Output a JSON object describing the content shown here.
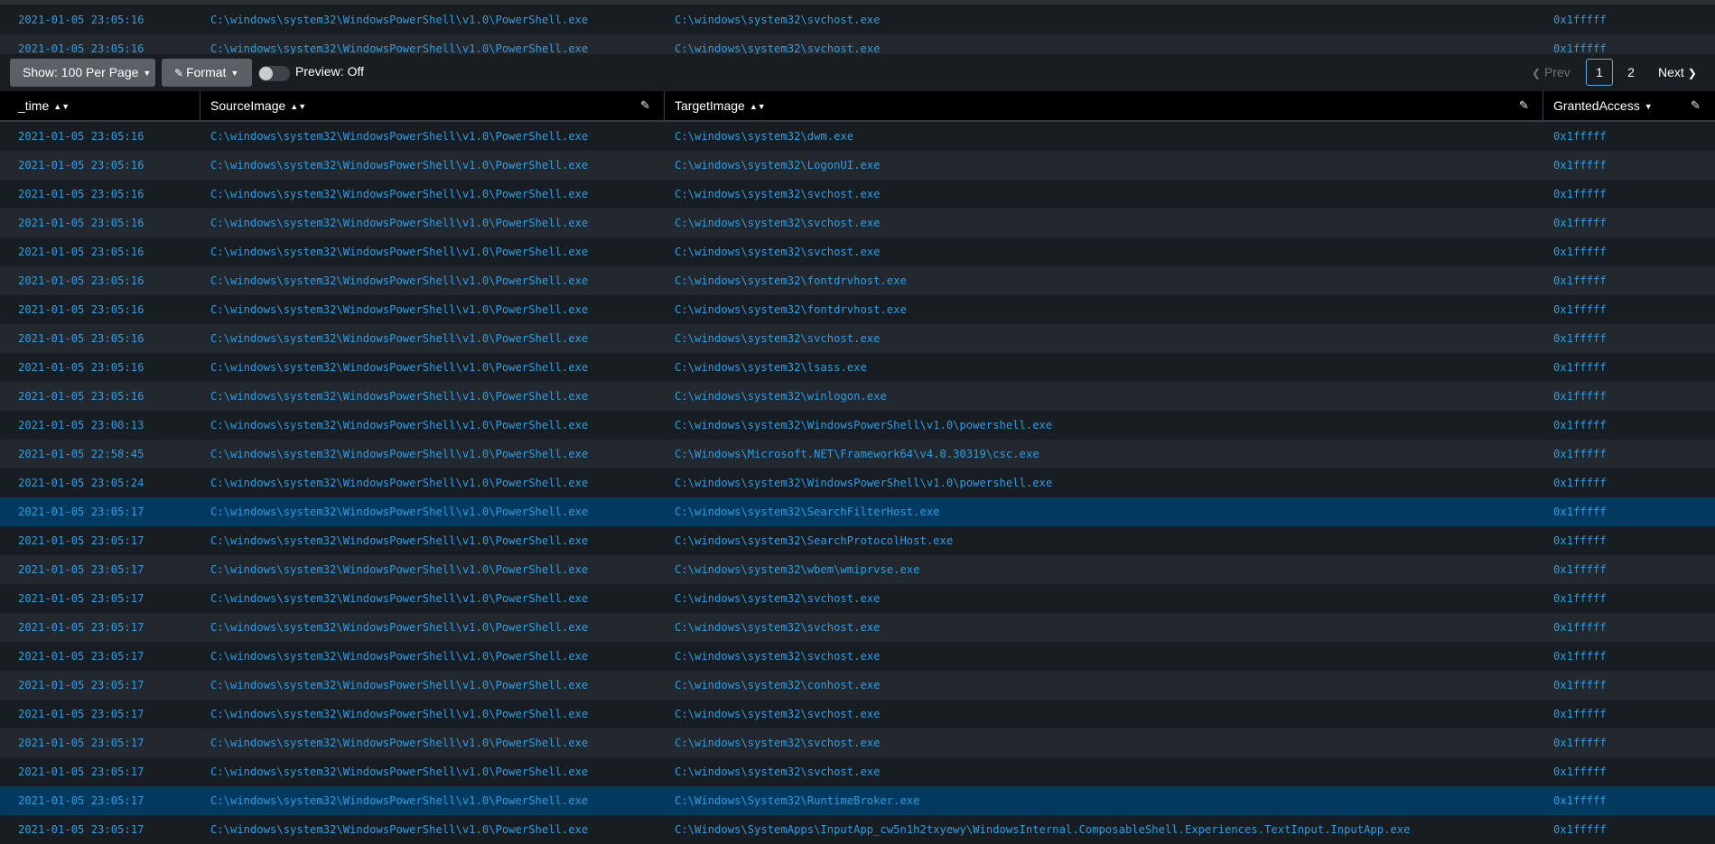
{
  "top_rows": [
    {
      "time": "2021-01-05 23:05:16",
      "source": "C:\\windows\\system32\\WindowsPowerShell\\v1.0\\PowerShell.exe",
      "target": "C:\\windows\\system32\\svchost.exe",
      "access": "0x1fffff"
    },
    {
      "time": "2021-01-05 23:05:16",
      "source": "C:\\windows\\system32\\WindowsPowerShell\\v1.0\\PowerShell.exe",
      "target": "C:\\windows\\system32\\svchost.exe",
      "access": "0x1fffff"
    }
  ],
  "toolbar": {
    "show_label": "Show: 100 Per Page",
    "format_label": "Format",
    "preview_label": "Preview: Off"
  },
  "pagination": {
    "prev_label": "Prev",
    "pages": [
      "1",
      "2"
    ],
    "current_page": "1",
    "next_label": "Next"
  },
  "columns": [
    "_time",
    "SourceImage",
    "TargetImage",
    "GrantedAccess"
  ],
  "rows": [
    {
      "time": "2021-01-05 23:05:16",
      "source": "C:\\windows\\system32\\WindowsPowerShell\\v1.0\\PowerShell.exe",
      "target": "C:\\windows\\system32\\dwm.exe",
      "access": "0x1fffff"
    },
    {
      "time": "2021-01-05 23:05:16",
      "source": "C:\\windows\\system32\\WindowsPowerShell\\v1.0\\PowerShell.exe",
      "target": "C:\\windows\\system32\\LogonUI.exe",
      "access": "0x1fffff"
    },
    {
      "time": "2021-01-05 23:05:16",
      "source": "C:\\windows\\system32\\WindowsPowerShell\\v1.0\\PowerShell.exe",
      "target": "C:\\windows\\system32\\svchost.exe",
      "access": "0x1fffff"
    },
    {
      "time": "2021-01-05 23:05:16",
      "source": "C:\\windows\\system32\\WindowsPowerShell\\v1.0\\PowerShell.exe",
      "target": "C:\\windows\\system32\\svchost.exe",
      "access": "0x1fffff"
    },
    {
      "time": "2021-01-05 23:05:16",
      "source": "C:\\windows\\system32\\WindowsPowerShell\\v1.0\\PowerShell.exe",
      "target": "C:\\windows\\system32\\svchost.exe",
      "access": "0x1fffff"
    },
    {
      "time": "2021-01-05 23:05:16",
      "source": "C:\\windows\\system32\\WindowsPowerShell\\v1.0\\PowerShell.exe",
      "target": "C:\\windows\\system32\\fontdrvhost.exe",
      "access": "0x1fffff"
    },
    {
      "time": "2021-01-05 23:05:16",
      "source": "C:\\windows\\system32\\WindowsPowerShell\\v1.0\\PowerShell.exe",
      "target": "C:\\windows\\system32\\fontdrvhost.exe",
      "access": "0x1fffff"
    },
    {
      "time": "2021-01-05 23:05:16",
      "source": "C:\\windows\\system32\\WindowsPowerShell\\v1.0\\PowerShell.exe",
      "target": "C:\\windows\\system32\\svchost.exe",
      "access": "0x1fffff"
    },
    {
      "time": "2021-01-05 23:05:16",
      "source": "C:\\windows\\system32\\WindowsPowerShell\\v1.0\\PowerShell.exe",
      "target": "C:\\windows\\system32\\lsass.exe",
      "access": "0x1fffff"
    },
    {
      "time": "2021-01-05 23:05:16",
      "source": "C:\\windows\\system32\\WindowsPowerShell\\v1.0\\PowerShell.exe",
      "target": "C:\\windows\\system32\\winlogon.exe",
      "access": "0x1fffff"
    },
    {
      "time": "2021-01-05 23:00:13",
      "source": "C:\\windows\\system32\\WindowsPowerShell\\v1.0\\PowerShell.exe",
      "target": "C:\\windows\\system32\\WindowsPowerShell\\v1.0\\powershell.exe",
      "access": "0x1fffff"
    },
    {
      "time": "2021-01-05 22:58:45",
      "source": "C:\\windows\\system32\\WindowsPowerShell\\v1.0\\PowerShell.exe",
      "target": "C:\\Windows\\Microsoft.NET\\Framework64\\v4.0.30319\\csc.exe",
      "access": "0x1fffff"
    },
    {
      "time": "2021-01-05 23:05:24",
      "source": "C:\\windows\\system32\\WindowsPowerShell\\v1.0\\PowerShell.exe",
      "target": "C:\\windows\\system32\\WindowsPowerShell\\v1.0\\powershell.exe",
      "access": "0x1fffff"
    },
    {
      "time": "2021-01-05 23:05:17",
      "source": "C:\\windows\\system32\\WindowsPowerShell\\v1.0\\PowerShell.exe",
      "target": "C:\\windows\\system32\\SearchFilterHost.exe",
      "access": "0x1fffff",
      "selected": true
    },
    {
      "time": "2021-01-05 23:05:17",
      "source": "C:\\windows\\system32\\WindowsPowerShell\\v1.0\\PowerShell.exe",
      "target": "C:\\windows\\system32\\SearchProtocolHost.exe",
      "access": "0x1fffff"
    },
    {
      "time": "2021-01-05 23:05:17",
      "source": "C:\\windows\\system32\\WindowsPowerShell\\v1.0\\PowerShell.exe",
      "target": "C:\\windows\\system32\\wbem\\wmiprvse.exe",
      "access": "0x1fffff"
    },
    {
      "time": "2021-01-05 23:05:17",
      "source": "C:\\windows\\system32\\WindowsPowerShell\\v1.0\\PowerShell.exe",
      "target": "C:\\windows\\system32\\svchost.exe",
      "access": "0x1fffff"
    },
    {
      "time": "2021-01-05 23:05:17",
      "source": "C:\\windows\\system32\\WindowsPowerShell\\v1.0\\PowerShell.exe",
      "target": "C:\\windows\\system32\\svchost.exe",
      "access": "0x1fffff"
    },
    {
      "time": "2021-01-05 23:05:17",
      "source": "C:\\windows\\system32\\WindowsPowerShell\\v1.0\\PowerShell.exe",
      "target": "C:\\windows\\system32\\svchost.exe",
      "access": "0x1fffff"
    },
    {
      "time": "2021-01-05 23:05:17",
      "source": "C:\\windows\\system32\\WindowsPowerShell\\v1.0\\PowerShell.exe",
      "target": "C:\\windows\\system32\\conhost.exe",
      "access": "0x1fffff"
    },
    {
      "time": "2021-01-05 23:05:17",
      "source": "C:\\windows\\system32\\WindowsPowerShell\\v1.0\\PowerShell.exe",
      "target": "C:\\windows\\system32\\svchost.exe",
      "access": "0x1fffff"
    },
    {
      "time": "2021-01-05 23:05:17",
      "source": "C:\\windows\\system32\\WindowsPowerShell\\v1.0\\PowerShell.exe",
      "target": "C:\\windows\\system32\\svchost.exe",
      "access": "0x1fffff"
    },
    {
      "time": "2021-01-05 23:05:17",
      "source": "C:\\windows\\system32\\WindowsPowerShell\\v1.0\\PowerShell.exe",
      "target": "C:\\windows\\system32\\svchost.exe",
      "access": "0x1fffff"
    },
    {
      "time": "2021-01-05 23:05:17",
      "source": "C:\\windows\\system32\\WindowsPowerShell\\v1.0\\PowerShell.exe",
      "target": "C:\\Windows\\System32\\RuntimeBroker.exe",
      "access": "0x1fffff",
      "selected": true
    },
    {
      "time": "2021-01-05 23:05:17",
      "source": "C:\\windows\\system32\\WindowsPowerShell\\v1.0\\PowerShell.exe",
      "target": "C:\\Windows\\SystemApps\\InputApp_cw5n1h2txyewy\\WindowsInternal.ComposableShell.Experiences.TextInput.InputApp.exe",
      "access": "0x1fffff"
    }
  ],
  "colors": {
    "background": "#171d21",
    "alt_row": "#22282d",
    "selected_row": "#02395e",
    "link": "#2e9de0",
    "header_bg": "#000000",
    "button_bg": "#5a6066"
  },
  "icons": {
    "sort": "sort-icon",
    "sort_desc": "sort-desc-icon",
    "edit": "pencil-icon",
    "prev": "chevron-left-icon",
    "next": "chevron-right-icon",
    "dropdown": "caret-down-icon"
  }
}
